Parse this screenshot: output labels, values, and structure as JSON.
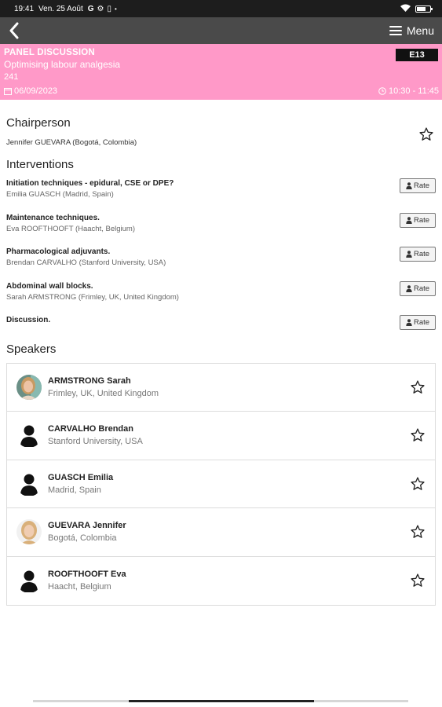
{
  "status_bar": {
    "time": "19:41",
    "date": "Ven. 25 Août",
    "icons": [
      "google-g-icon",
      "settings-icon",
      "battery-saver-icon",
      "dot-icon"
    ],
    "right_icons": [
      "wifi-icon",
      "battery-icon"
    ]
  },
  "app_bar": {
    "menu_label": "Menu"
  },
  "session": {
    "type": "PANEL DISCUSSION",
    "title": "Optimising labour analgesia",
    "room": "241",
    "code": "E13",
    "date": "06/09/2023",
    "time": "10:30 - 11:45",
    "background": "#ff99c8"
  },
  "chairperson": {
    "heading": "Chairperson",
    "name": "Jennifer GUEVARA (Bogotá, Colombia)"
  },
  "interventions": {
    "heading": "Interventions",
    "rate_label": "Rate",
    "items": [
      {
        "title": "Initiation techniques - epidural, CSE or DPE?",
        "speaker": "Emilia GUASCH (Madrid, Spain)"
      },
      {
        "title": "Maintenance techniques.",
        "speaker": "Eva ROOFTHOOFT (Haacht, Belgium)"
      },
      {
        "title": "Pharmacological adjuvants.",
        "speaker": "Brendan CARVALHO (Stanford University, USA)"
      },
      {
        "title": "Abdominal wall blocks.",
        "speaker": "Sarah ARMSTRONG (Frimley, UK, United Kingdom)"
      },
      {
        "title": "Discussion.",
        "speaker": ""
      }
    ]
  },
  "speakers": {
    "heading": "Speakers",
    "items": [
      {
        "name": "ARMSTRONG Sarah",
        "location": "Frimley, UK, United Kingdom",
        "avatar": "photo"
      },
      {
        "name": "CARVALHO Brendan",
        "location": "Stanford University, USA",
        "avatar": "silhouette"
      },
      {
        "name": "GUASCH Emilia",
        "location": "Madrid, Spain",
        "avatar": "silhouette"
      },
      {
        "name": "GUEVARA Jennifer",
        "location": "Bogotá, Colombia",
        "avatar": "photo"
      },
      {
        "name": "ROOFTHOOFT Eva",
        "location": "Haacht, Belgium",
        "avatar": "silhouette"
      }
    ]
  }
}
